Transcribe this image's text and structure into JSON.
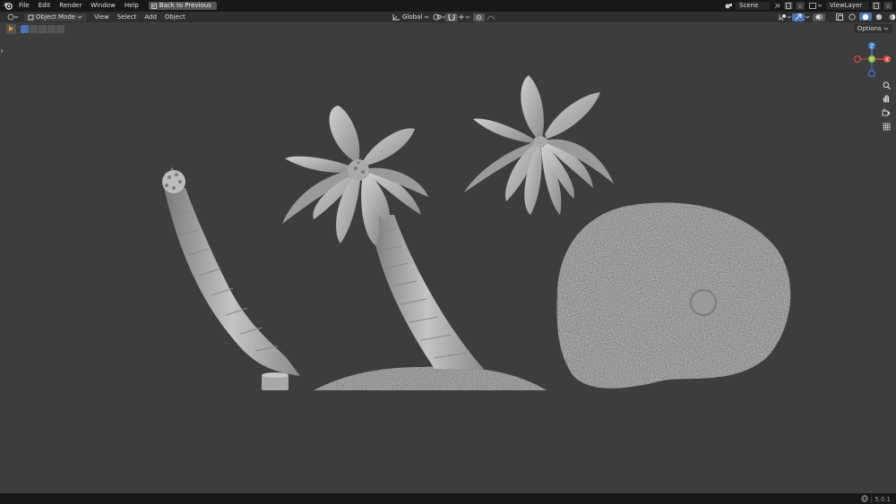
{
  "menu": {
    "items": [
      "File",
      "Edit",
      "Render",
      "Window",
      "Help"
    ],
    "back_button": "Back to Previous"
  },
  "top_right": {
    "scene": "Scene",
    "view_layer": "ViewLayer"
  },
  "header": {
    "mode": "Object Mode",
    "menus": [
      "View",
      "Select",
      "Add",
      "Object"
    ],
    "transform_orientation": "Global"
  },
  "viewport": {
    "options_label": "Options",
    "gizmo": {
      "x": "X",
      "y": "Y",
      "z": "Z"
    }
  },
  "status": {
    "version": "5.0.1"
  }
}
